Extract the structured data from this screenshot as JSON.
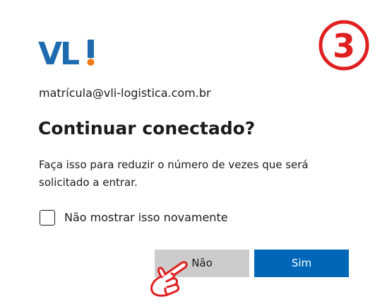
{
  "logo": {
    "text": "VLI",
    "icon": "vli-logo"
  },
  "step_badge": {
    "number": "3",
    "color": "#e02020"
  },
  "account": {
    "email": "matrícula@vli-logistica.com.br"
  },
  "dialog": {
    "title": "Continuar conectado?",
    "description": "Faça isso para reduzir o número de vezes que será solicitado a entrar.",
    "checkbox_label": "Não mostrar isso novamente",
    "checkbox_checked": false
  },
  "buttons": {
    "no_label": "Não",
    "yes_label": "Sim"
  },
  "colors": {
    "primary": "#0067b8",
    "secondary_button": "#cccccc",
    "logo_blue": "#1f6bb0",
    "logo_orange": "#f07c1a",
    "annotation_red": "#e02020"
  },
  "pointer": {
    "icon": "pointing-hand-icon"
  }
}
